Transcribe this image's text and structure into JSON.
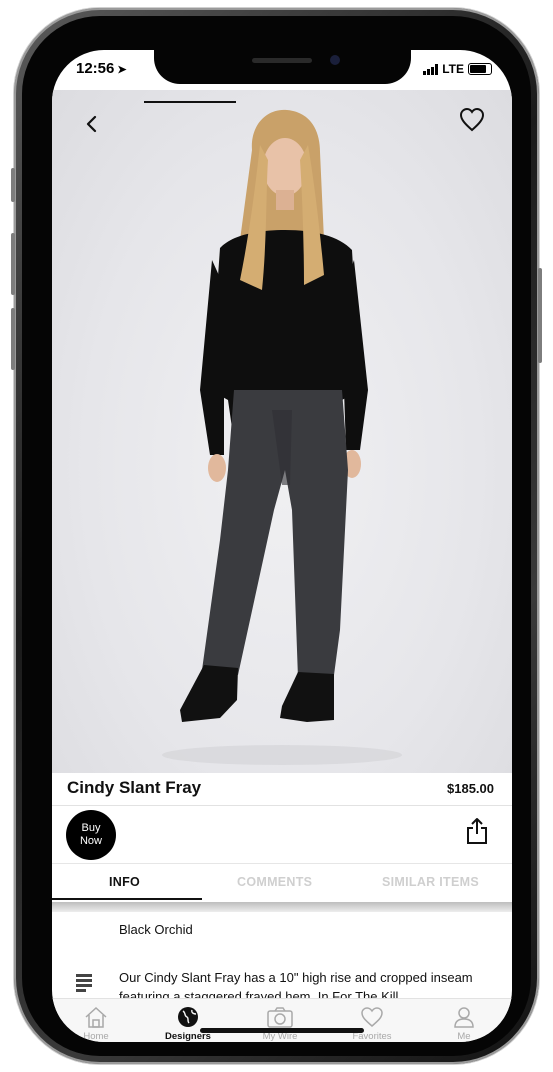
{
  "status_bar": {
    "time": "12:56",
    "network": "LTE"
  },
  "product": {
    "name": "Cindy Slant Fray",
    "price": "$185.00"
  },
  "actions": {
    "buy_line1": "Buy",
    "buy_line2": "Now"
  },
  "tabs": [
    {
      "label": "INFO",
      "active": true
    },
    {
      "label": "COMMENTS",
      "active": false
    },
    {
      "label": "SIMILAR ITEMS",
      "active": false
    }
  ],
  "info": {
    "color": "Black Orchid",
    "description": "Our Cindy Slant Fray has a 10\" high rise and cropped inseam featuring a staggered frayed hem. In For The Kill"
  },
  "bottom_nav": [
    {
      "label": "Home",
      "icon": "home-icon",
      "active": false
    },
    {
      "label": "Designers",
      "icon": "globe-icon",
      "active": true
    },
    {
      "label": "My Wire",
      "icon": "camera-icon",
      "active": false
    },
    {
      "label": "Favorites",
      "icon": "heart-icon",
      "active": false
    },
    {
      "label": "Me",
      "icon": "person-icon",
      "active": false
    }
  ],
  "colors": {
    "accent": "#000000",
    "inactive_tab": "#cfcfcf",
    "nav_inactive": "#a9a9a9"
  }
}
